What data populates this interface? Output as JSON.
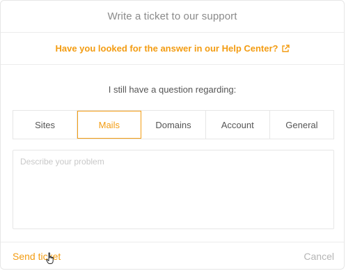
{
  "header": {
    "title": "Write a ticket to our support"
  },
  "help": {
    "link_label": "Have you looked for the answer in our Help Center?",
    "icon": "external-link-icon"
  },
  "question": {
    "label": "I still have a question regarding:"
  },
  "tabs": [
    {
      "label": "Sites",
      "selected": false
    },
    {
      "label": "Mails",
      "selected": true
    },
    {
      "label": "Domains",
      "selected": false
    },
    {
      "label": "Account",
      "selected": false
    },
    {
      "label": "General",
      "selected": false
    }
  ],
  "problem": {
    "placeholder": "Describe your problem",
    "value": ""
  },
  "footer": {
    "send_label": "Send ticket",
    "cancel_label": "Cancel"
  },
  "colors": {
    "accent": "#f39c12",
    "muted": "#b5b5b5",
    "border": "#e6e6e6"
  },
  "cursor": {
    "icon": "hand-pointer-icon"
  }
}
